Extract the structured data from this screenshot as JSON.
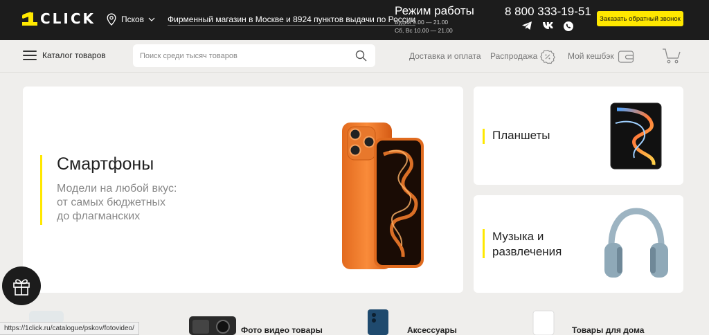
{
  "header": {
    "logo_text": "CLICK",
    "logo_digit": "1",
    "city": "Псков",
    "store_link": "Фирменный магазин в Москве и 8924 пунктов выдачи по России",
    "hours_title": "Режим работы",
    "hours_weekdays": "Будни 9.00 — 21.00",
    "hours_weekend": "Сб, Вс 10.00 — 21.00",
    "phone": "8 800 333-19-51",
    "callback_label": "Заказать обратный звонок",
    "socials": [
      "telegram-icon",
      "vk-icon",
      "whatsapp-icon"
    ]
  },
  "nav": {
    "catalog_label": "Каталог товаров",
    "search_placeholder": "Поиск среди тысяч товаров",
    "delivery_label": "Доставка и оплата",
    "sale_label": "Распродажа",
    "cashback_label": "Мой кешбэк"
  },
  "cards": {
    "smartphones": {
      "title": "Смартфоны",
      "subtitle_lines": [
        "Модели на любой вкус:",
        "от самых бюджетных",
        "до флагманских"
      ]
    },
    "tablets": {
      "title": "Планшеты"
    },
    "music": {
      "title_lines": [
        "Музыка и",
        "развлечения"
      ]
    }
  },
  "bottom_categories": [
    "Фото видео товары",
    "Аксессуары",
    "Товары для дома"
  ],
  "status_url": "https://1click.ru/catalogue/pskov/fotovideo/",
  "colors": {
    "accent": "#ffe800",
    "topbar": "#1c1c1c",
    "background": "#efeeec"
  }
}
